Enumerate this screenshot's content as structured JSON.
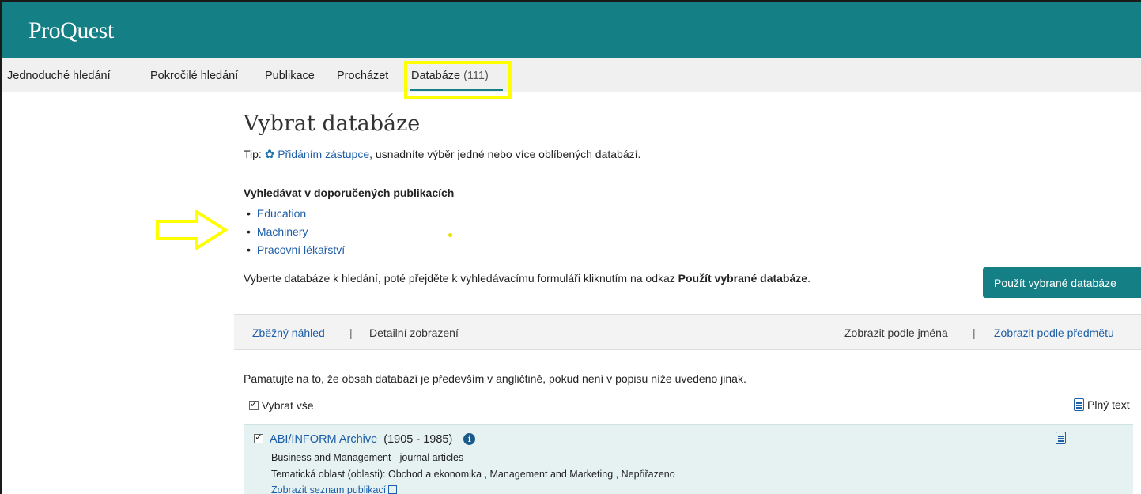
{
  "app": {
    "logo": "ProQuest"
  },
  "nav": {
    "items": [
      {
        "label": "Jednoduché hledání"
      },
      {
        "label": "Pokročilé hledání"
      },
      {
        "label": "Publikace"
      },
      {
        "label": "Procházet"
      },
      {
        "label": "Databáze",
        "count": "(111)",
        "active": true
      }
    ]
  },
  "page": {
    "title": "Vybrat databáze",
    "tip": {
      "prefix": "Tip:",
      "link": "Přidáním zástupce",
      "suffix": ", usnadníte výběr jedné nebo více oblíbených databází."
    },
    "recommended": {
      "heading": "Vyhledávat v doporučených publikacích",
      "items": [
        "Education",
        "Machinery",
        "Pracovní lékařství"
      ]
    },
    "instruction": {
      "text": "Vyberte databáze k hledání, poté přejděte k vyhledávacímu formuláři kliknutím na odkaz ",
      "bold": "Použít vybrané databáze",
      "end": "."
    },
    "use_button": "Použít vybrané databáze",
    "view_bar": {
      "brief": "Zběžný náhled",
      "detailed": "Detailní zobrazení",
      "by_name": "Zobrazit podle jména",
      "by_subject": "Zobrazit podle předmětu",
      "separator": "|"
    },
    "language_note": "Pamatujte na to, že obsah databází je především v angličtině, pokud není v popisu níže uvedeno jinak.",
    "select_all": {
      "label": "Vybrat vše",
      "checked": true
    },
    "fulltext_header": "Plný text",
    "databases": [
      {
        "name": "ABI/INFORM Archive",
        "years": "(1905 - 1985)",
        "checked": true,
        "description": "Business and Management - journal articles",
        "subjects": "Tematická oblast (oblasti): Obchod a ekonomika , Management and Marketing , Nepřiřazeno",
        "list_link": "Zobrazit seznam publikací"
      }
    ]
  },
  "colors": {
    "brand": "#157f86",
    "link": "#1d5ea8",
    "highlight": "#ffff00",
    "row_bg": "#e6f2f2"
  },
  "icons": [
    "gear-icon",
    "info-icon",
    "full-text-document-icon",
    "external-link-icon",
    "checkbox-checked-icon"
  ]
}
